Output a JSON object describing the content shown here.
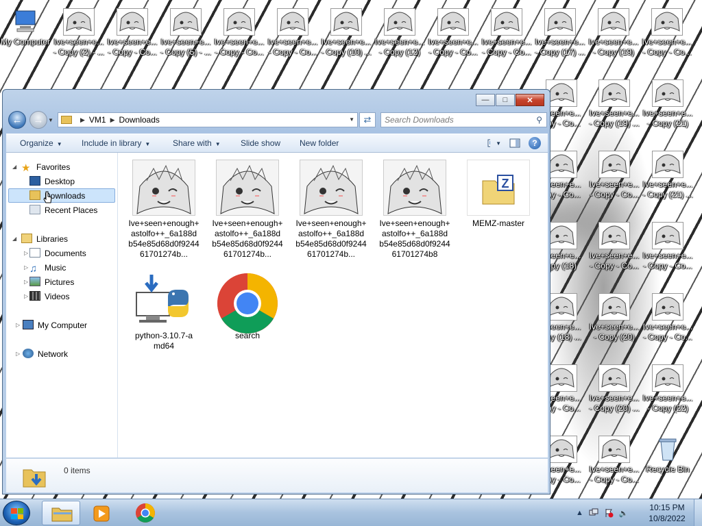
{
  "desktop": {
    "top_row": [
      {
        "line1": "My Computer",
        "line2": ""
      },
      {
        "line1": "Ive+seen+e...",
        "line2": "- Copy (2) - ..."
      },
      {
        "line1": "Ive+seen+e...",
        "line2": "- Copy - Co..."
      },
      {
        "line1": "Ive+seen+e...",
        "line2": "- Copy (5) - ..."
      },
      {
        "line1": "Ive+seen+e...",
        "line2": "- Copy - Co..."
      },
      {
        "line1": "Ive+seen+e...",
        "line2": "- Copy - Co..."
      },
      {
        "line1": "Ive+seen+e...",
        "line2": "- Copy (10) ..."
      },
      {
        "line1": "Ive+seen+e...",
        "line2": "- Copy (12)"
      },
      {
        "line1": "Ive+seen+e...",
        "line2": "- Copy - Co..."
      },
      {
        "line1": "Ive+seen+e...",
        "line2": "- Copy - Co..."
      },
      {
        "line1": "Ive+seen+e...",
        "line2": "- Copy (17) ..."
      },
      {
        "line1": "Ive+seen+e...",
        "line2": "- Copy (19)"
      },
      {
        "line1": "Ive+seen+e...",
        "line2": "- Copy - Co..."
      }
    ],
    "right_cols": [
      [
        {
          "line1": "+seen+e...",
          "line2": "opy - Co..."
        },
        {
          "line1": "+seen+e...",
          "line2": "opy - Co..."
        },
        {
          "line1": "+seen+e...",
          "line2": "opy (18)"
        },
        {
          "line1": "+seen+e...",
          "line2": "opy (18) ..."
        },
        {
          "line1": "+seen+e...",
          "line2": "opy - Co..."
        },
        {
          "line1": "+seen+e...",
          "line2": "opy - Co..."
        }
      ],
      [
        {
          "line1": "Ive+seen+e...",
          "line2": "- Copy (19) ..."
        },
        {
          "line1": "Ive+seen+e...",
          "line2": "- Copy - Co..."
        },
        {
          "line1": "Ive+seen+e...",
          "line2": "- Copy - Co..."
        },
        {
          "line1": "Ive+seen+e...",
          "line2": "- Copy (20)"
        },
        {
          "line1": "Ive+seen+e...",
          "line2": "- Copy (20) ..."
        },
        {
          "line1": "Ive+seen+e...",
          "line2": "- Copy - Co..."
        }
      ],
      [
        {
          "line1": "Ive+seen+e...",
          "line2": "- Copy (21)"
        },
        {
          "line1": "Ive+seen+e...",
          "line2": "- Copy (21) ..."
        },
        {
          "line1": "Ive+seen+e...",
          "line2": "- Copy - Co..."
        },
        {
          "line1": "Ive+seen+e...",
          "line2": "- Copy - Co..."
        },
        {
          "line1": "Ive+seen+e...",
          "line2": "- Copy (22)"
        },
        {
          "line1": "Recycle Bin",
          "line2": ""
        }
      ]
    ]
  },
  "window": {
    "address": {
      "root": "VM1",
      "current": "Downloads"
    },
    "search_placeholder": "Search Downloads",
    "toolbar": {
      "organize": "Organize",
      "include_in_library": "Include in library",
      "share_with": "Share with",
      "slide_show": "Slide show",
      "new_folder": "New folder"
    },
    "nav": {
      "favorites": "Favorites",
      "desktop": "Desktop",
      "downloads": "Downloads",
      "recent_places": "Recent Places",
      "libraries": "Libraries",
      "documents": "Documents",
      "music": "Music",
      "pictures": "Pictures",
      "videos": "Videos",
      "my_computer": "My Computer",
      "network": "Network"
    },
    "files": [
      {
        "name": "Ive+seen+enough+astolfo++_6a188db54e85d68d0f924461701274b...",
        "kind": "image"
      },
      {
        "name": "Ive+seen+enough+astolfo++_6a188db54e85d68d0f924461701274b...",
        "kind": "image"
      },
      {
        "name": "Ive+seen+enough+astolfo++_6a188db54e85d68d0f924461701274b...",
        "kind": "image"
      },
      {
        "name": "Ive+seen+enough+astolfo++_6a188db54e85d68d0f924461701274b8",
        "kind": "image"
      },
      {
        "name": "MEMZ-master",
        "kind": "zip"
      },
      {
        "name": "python-3.10.7-amd64",
        "kind": "python"
      },
      {
        "name": "search",
        "kind": "chrome"
      }
    ],
    "details": {
      "count": "0 items"
    }
  },
  "taskbar": {
    "time": "10:15 PM",
    "date": "10/8/2022"
  },
  "colors": {
    "accent": "#3c76b8",
    "selection": "#cce4fb",
    "folder": "#e8c25a"
  }
}
